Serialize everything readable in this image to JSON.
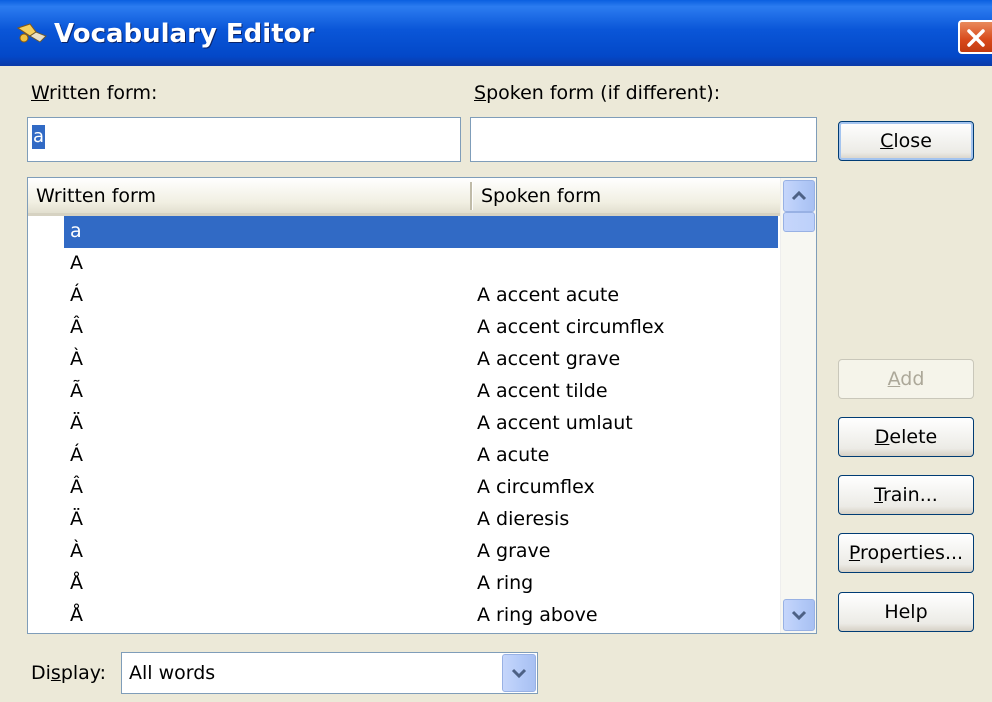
{
  "window": {
    "title": "Vocabulary Editor"
  },
  "labels": {
    "written_form_prefix": "W",
    "written_form_rest": "ritten form:",
    "spoken_form_prefix": "S",
    "spoken_form_rest": "poken form (if different):",
    "display_prefix": "Di",
    "display_u": "s",
    "display_rest": "play:"
  },
  "inputs": {
    "written_value": "a",
    "spoken_value": ""
  },
  "list": {
    "columns": [
      "Written form",
      "Spoken form"
    ],
    "rows": [
      {
        "written": "a",
        "spoken": ""
      },
      {
        "written": "A",
        "spoken": ""
      },
      {
        "written": "Á",
        "spoken": "A accent acute"
      },
      {
        "written": "Â",
        "spoken": "A accent circumflex"
      },
      {
        "written": "À",
        "spoken": "A accent grave"
      },
      {
        "written": "Ã",
        "spoken": "A accent tilde"
      },
      {
        "written": "Ä",
        "spoken": "A accent umlaut"
      },
      {
        "written": "Á",
        "spoken": "A acute"
      },
      {
        "written": "Â",
        "spoken": "A circumflex"
      },
      {
        "written": "Ä",
        "spoken": "A dieresis"
      },
      {
        "written": "À",
        "spoken": "A grave"
      },
      {
        "written": "Å",
        "spoken": "A ring"
      },
      {
        "written": "Å",
        "spoken": "A ring above"
      }
    ]
  },
  "buttons": {
    "close_u": "C",
    "close_rest": "lose",
    "add_u": "A",
    "add_rest": "dd",
    "delete_u": "D",
    "delete_rest": "elete",
    "train_u": "T",
    "train_rest": "rain...",
    "properties_u": "P",
    "properties_rest": "roperties...",
    "help": "Help"
  },
  "display": {
    "selected": "All words"
  },
  "colors": {
    "titlebar": "#0a56d8",
    "selection": "#316ac5",
    "close_button": "#d8491a",
    "face": "#ece9d8"
  }
}
